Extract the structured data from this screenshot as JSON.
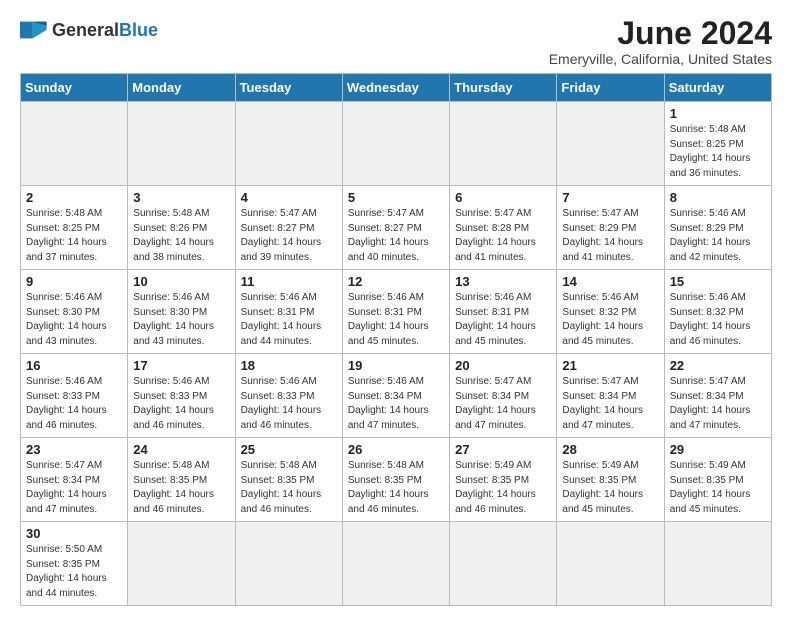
{
  "header": {
    "logo_general": "General",
    "logo_blue": "Blue",
    "month_title": "June 2024",
    "location": "Emeryville, California, United States"
  },
  "weekdays": [
    "Sunday",
    "Monday",
    "Tuesday",
    "Wednesday",
    "Thursday",
    "Friday",
    "Saturday"
  ],
  "weeks": [
    [
      {
        "day": "",
        "info": ""
      },
      {
        "day": "",
        "info": ""
      },
      {
        "day": "",
        "info": ""
      },
      {
        "day": "",
        "info": ""
      },
      {
        "day": "",
        "info": ""
      },
      {
        "day": "",
        "info": ""
      },
      {
        "day": "1",
        "info": "Sunrise: 5:48 AM\nSunset: 8:25 PM\nDaylight: 14 hours and 36 minutes."
      }
    ],
    [
      {
        "day": "2",
        "info": "Sunrise: 5:48 AM\nSunset: 8:25 PM\nDaylight: 14 hours and 37 minutes."
      },
      {
        "day": "3",
        "info": "Sunrise: 5:48 AM\nSunset: 8:26 PM\nDaylight: 14 hours and 38 minutes."
      },
      {
        "day": "4",
        "info": "Sunrise: 5:47 AM\nSunset: 8:27 PM\nDaylight: 14 hours and 39 minutes."
      },
      {
        "day": "5",
        "info": "Sunrise: 5:47 AM\nSunset: 8:27 PM\nDaylight: 14 hours and 40 minutes."
      },
      {
        "day": "6",
        "info": "Sunrise: 5:47 AM\nSunset: 8:28 PM\nDaylight: 14 hours and 41 minutes."
      },
      {
        "day": "7",
        "info": "Sunrise: 5:47 AM\nSunset: 8:29 PM\nDaylight: 14 hours and 41 minutes."
      },
      {
        "day": "8",
        "info": "Sunrise: 5:46 AM\nSunset: 8:29 PM\nDaylight: 14 hours and 42 minutes."
      }
    ],
    [
      {
        "day": "9",
        "info": "Sunrise: 5:46 AM\nSunset: 8:30 PM\nDaylight: 14 hours and 43 minutes."
      },
      {
        "day": "10",
        "info": "Sunrise: 5:46 AM\nSunset: 8:30 PM\nDaylight: 14 hours and 43 minutes."
      },
      {
        "day": "11",
        "info": "Sunrise: 5:46 AM\nSunset: 8:31 PM\nDaylight: 14 hours and 44 minutes."
      },
      {
        "day": "12",
        "info": "Sunrise: 5:46 AM\nSunset: 8:31 PM\nDaylight: 14 hours and 45 minutes."
      },
      {
        "day": "13",
        "info": "Sunrise: 5:46 AM\nSunset: 8:31 PM\nDaylight: 14 hours and 45 minutes."
      },
      {
        "day": "14",
        "info": "Sunrise: 5:46 AM\nSunset: 8:32 PM\nDaylight: 14 hours and 45 minutes."
      },
      {
        "day": "15",
        "info": "Sunrise: 5:46 AM\nSunset: 8:32 PM\nDaylight: 14 hours and 46 minutes."
      }
    ],
    [
      {
        "day": "16",
        "info": "Sunrise: 5:46 AM\nSunset: 8:33 PM\nDaylight: 14 hours and 46 minutes."
      },
      {
        "day": "17",
        "info": "Sunrise: 5:46 AM\nSunset: 8:33 PM\nDaylight: 14 hours and 46 minutes."
      },
      {
        "day": "18",
        "info": "Sunrise: 5:46 AM\nSunset: 8:33 PM\nDaylight: 14 hours and 46 minutes."
      },
      {
        "day": "19",
        "info": "Sunrise: 5:46 AM\nSunset: 8:34 PM\nDaylight: 14 hours and 47 minutes."
      },
      {
        "day": "20",
        "info": "Sunrise: 5:47 AM\nSunset: 8:34 PM\nDaylight: 14 hours and 47 minutes."
      },
      {
        "day": "21",
        "info": "Sunrise: 5:47 AM\nSunset: 8:34 PM\nDaylight: 14 hours and 47 minutes."
      },
      {
        "day": "22",
        "info": "Sunrise: 5:47 AM\nSunset: 8:34 PM\nDaylight: 14 hours and 47 minutes."
      }
    ],
    [
      {
        "day": "23",
        "info": "Sunrise: 5:47 AM\nSunset: 8:34 PM\nDaylight: 14 hours and 47 minutes."
      },
      {
        "day": "24",
        "info": "Sunrise: 5:48 AM\nSunset: 8:35 PM\nDaylight: 14 hours and 46 minutes."
      },
      {
        "day": "25",
        "info": "Sunrise: 5:48 AM\nSunset: 8:35 PM\nDaylight: 14 hours and 46 minutes."
      },
      {
        "day": "26",
        "info": "Sunrise: 5:48 AM\nSunset: 8:35 PM\nDaylight: 14 hours and 46 minutes."
      },
      {
        "day": "27",
        "info": "Sunrise: 5:49 AM\nSunset: 8:35 PM\nDaylight: 14 hours and 46 minutes."
      },
      {
        "day": "28",
        "info": "Sunrise: 5:49 AM\nSunset: 8:35 PM\nDaylight: 14 hours and 45 minutes."
      },
      {
        "day": "29",
        "info": "Sunrise: 5:49 AM\nSunset: 8:35 PM\nDaylight: 14 hours and 45 minutes."
      }
    ],
    [
      {
        "day": "30",
        "info": "Sunrise: 5:50 AM\nSunset: 8:35 PM\nDaylight: 14 hours and 44 minutes."
      },
      {
        "day": "",
        "info": ""
      },
      {
        "day": "",
        "info": ""
      },
      {
        "day": "",
        "info": ""
      },
      {
        "day": "",
        "info": ""
      },
      {
        "day": "",
        "info": ""
      },
      {
        "day": "",
        "info": ""
      }
    ]
  ]
}
